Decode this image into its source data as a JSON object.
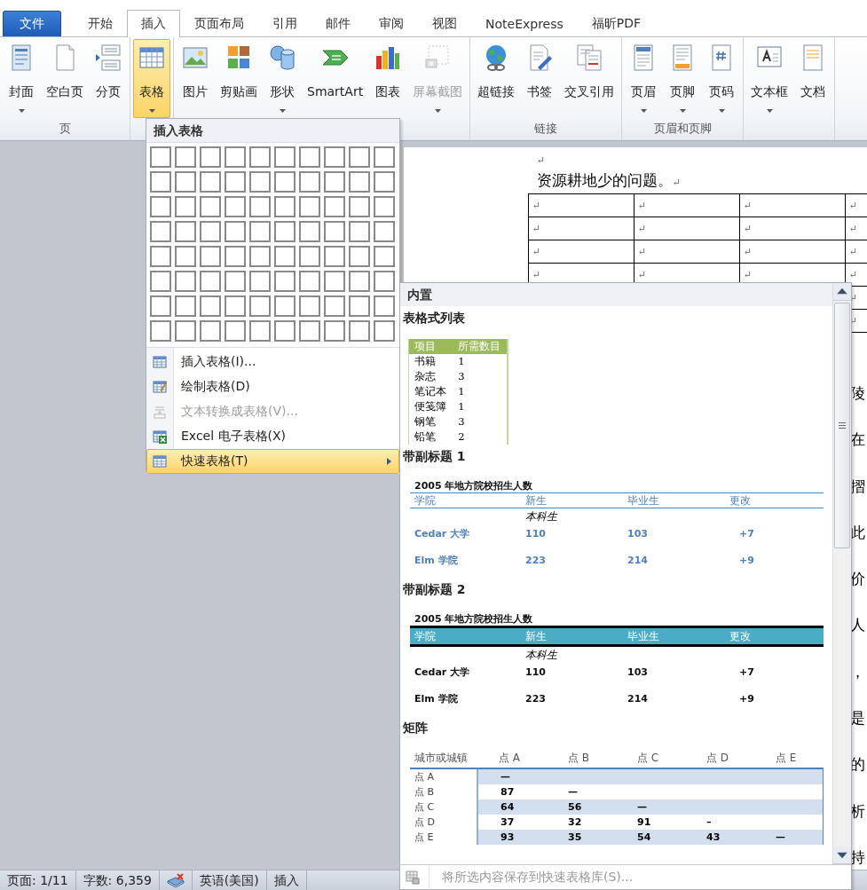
{
  "tabs": [
    {
      "label": "文件",
      "kind": "file",
      "selected": false
    },
    {
      "label": "开始",
      "kind": "tab",
      "selected": false
    },
    {
      "label": "插入",
      "kind": "tab",
      "selected": true
    },
    {
      "label": "页面布局",
      "kind": "tab",
      "selected": false
    },
    {
      "label": "引用",
      "kind": "tab",
      "selected": false
    },
    {
      "label": "邮件",
      "kind": "tab",
      "selected": false
    },
    {
      "label": "审阅",
      "kind": "tab",
      "selected": false
    },
    {
      "label": "视图",
      "kind": "tab",
      "selected": false
    },
    {
      "label": "NoteExpress",
      "kind": "tab",
      "selected": false
    },
    {
      "label": "福昕PDF",
      "kind": "tab",
      "selected": false
    }
  ],
  "ribbon": {
    "groups": [
      {
        "label": "页",
        "buttons": [
          {
            "label": "封面",
            "dropdown": true,
            "disabled": false,
            "selected": false
          },
          {
            "label": "空白页",
            "dropdown": false,
            "disabled": false,
            "selected": false
          },
          {
            "label": "分页",
            "dropdown": false,
            "disabled": false,
            "selected": false
          }
        ]
      },
      {
        "buttons": [
          {
            "label": "表格",
            "dropdown": true,
            "disabled": false,
            "selected": true
          }
        ]
      },
      {
        "buttons": [
          {
            "label": "图片",
            "dropdown": false,
            "disabled": false,
            "selected": false
          },
          {
            "label": "剪贴画",
            "dropdown": false,
            "disabled": false,
            "selected": false
          },
          {
            "label": "形状",
            "dropdown": true,
            "disabled": false,
            "selected": false
          },
          {
            "label": "SmartArt",
            "dropdown": false,
            "disabled": false,
            "selected": false
          },
          {
            "label": "图表",
            "dropdown": false,
            "disabled": false,
            "selected": false
          },
          {
            "label": "屏幕截图",
            "dropdown": true,
            "disabled": true,
            "selected": false
          }
        ]
      },
      {
        "label": "链接",
        "buttons": [
          {
            "label": "超链接",
            "dropdown": false,
            "disabled": false,
            "selected": false
          },
          {
            "label": "书签",
            "dropdown": false,
            "disabled": false,
            "selected": false
          },
          {
            "label": "交叉引用",
            "dropdown": false,
            "disabled": false,
            "selected": false
          }
        ]
      },
      {
        "label": "页眉和页脚",
        "buttons": [
          {
            "label": "页眉",
            "dropdown": true,
            "disabled": false,
            "selected": false
          },
          {
            "label": "页脚",
            "dropdown": true,
            "disabled": false,
            "selected": false
          },
          {
            "label": "页码",
            "dropdown": true,
            "disabled": false,
            "selected": false
          }
        ]
      },
      {
        "buttons": [
          {
            "label": "文本框",
            "dropdown": true,
            "disabled": false,
            "selected": false
          },
          {
            "label": "文档",
            "dropdown": false,
            "disabled": false,
            "selected": false
          }
        ]
      }
    ]
  },
  "document": {
    "empty_paragraph": "↵",
    "paragraph": {
      "text": "资源耕地少的问题。",
      "mark": "↵"
    },
    "table_rows": [
      {
        "cells": [
          "↵",
          "↵",
          "↵",
          "↵"
        ]
      },
      {
        "cells": [
          "↵",
          "↵",
          "↵",
          "↵"
        ]
      },
      {
        "cells": [
          "↵",
          "↵",
          "↵",
          "↵"
        ]
      },
      {
        "cells": [
          "↵",
          "↵",
          "↵",
          "↵"
        ]
      },
      {
        "cells": [
          "↵"
        ]
      },
      {
        "cells": [
          "↵"
        ]
      }
    ],
    "line_starts": [
      "陵",
      "在",
      "摺",
      "此",
      "价",
      "人",
      "，",
      "是",
      "的",
      "析",
      "持"
    ]
  },
  "insert_table_menu": {
    "title": "插入表格",
    "items": [
      {
        "label": "插入表格(I)...",
        "disabled": false,
        "selected": false,
        "submenu": false
      },
      {
        "label": "绘制表格(D)",
        "disabled": false,
        "selected": false,
        "submenu": false
      },
      {
        "label": "文本转换成表格(V)...",
        "disabled": true,
        "selected": false,
        "submenu": false
      },
      {
        "label": "Excel 电子表格(X)",
        "disabled": false,
        "selected": false,
        "submenu": false
      },
      {
        "label": "快速表格(T)",
        "disabled": false,
        "selected": true,
        "submenu": true
      }
    ]
  },
  "quick_tables_gallery": {
    "header": "内置",
    "sections": [
      {
        "kind": "tabular_list",
        "title": "表格式列表",
        "columns": [
          "项目",
          "所需数目"
        ],
        "rows": [
          [
            "书籍",
            "1"
          ],
          [
            "杂志",
            "3"
          ],
          [
            "笔记本",
            "1"
          ],
          [
            "便笺簿",
            "1"
          ],
          [
            "钢笔",
            "3"
          ],
          [
            "铅笔",
            "2"
          ]
        ]
      },
      {
        "kind": "subheading_1",
        "title": "带副标题 1",
        "caption": "2005  年地方院校招生人数",
        "columns": [
          "学院",
          "新生",
          "毕业生",
          "更改"
        ],
        "group": "本科生",
        "rows": [
          [
            "Cedar 大学",
            "110",
            "103",
            "+7"
          ],
          [
            "Elm  学院",
            "223",
            "214",
            "+9"
          ]
        ]
      },
      {
        "kind": "subheading_2",
        "title": "带副标题 2",
        "caption": "2005  年地方院校招生人数",
        "columns": [
          "学院",
          "新生",
          "毕业生",
          "更改"
        ],
        "group": "本科生",
        "rows": [
          [
            "Cedar 大学",
            "110",
            "103",
            "+7"
          ],
          [
            "Elm  学院",
            "223",
            "214",
            "+9"
          ]
        ]
      },
      {
        "kind": "matrix",
        "title": "矩阵",
        "columns": [
          "城市或城镇",
          "点  A",
          "点  B",
          "点  C",
          "点  D",
          "点  E"
        ],
        "rows": [
          [
            "点  A",
            "—",
            "",
            "",
            "",
            ""
          ],
          [
            "点  B",
            "87",
            "—",
            "",
            "",
            ""
          ],
          [
            "点  C",
            "64",
            "56",
            "—",
            "",
            ""
          ],
          [
            "点  D",
            "37",
            "32",
            "91",
            "–",
            ""
          ],
          [
            "点  E",
            "93",
            "35",
            "54",
            "43",
            "—"
          ]
        ]
      }
    ],
    "footer": {
      "label": "将所选内容保存到快速表格库(S)...",
      "disabled": true
    }
  },
  "status_bar": [
    {
      "kind": "text",
      "label": "页面: 1/11"
    },
    {
      "kind": "text",
      "label": "字数: 6,359"
    },
    {
      "kind": "icon"
    },
    {
      "kind": "text",
      "label": "英语(美国)"
    },
    {
      "kind": "text",
      "label": "插入"
    }
  ]
}
